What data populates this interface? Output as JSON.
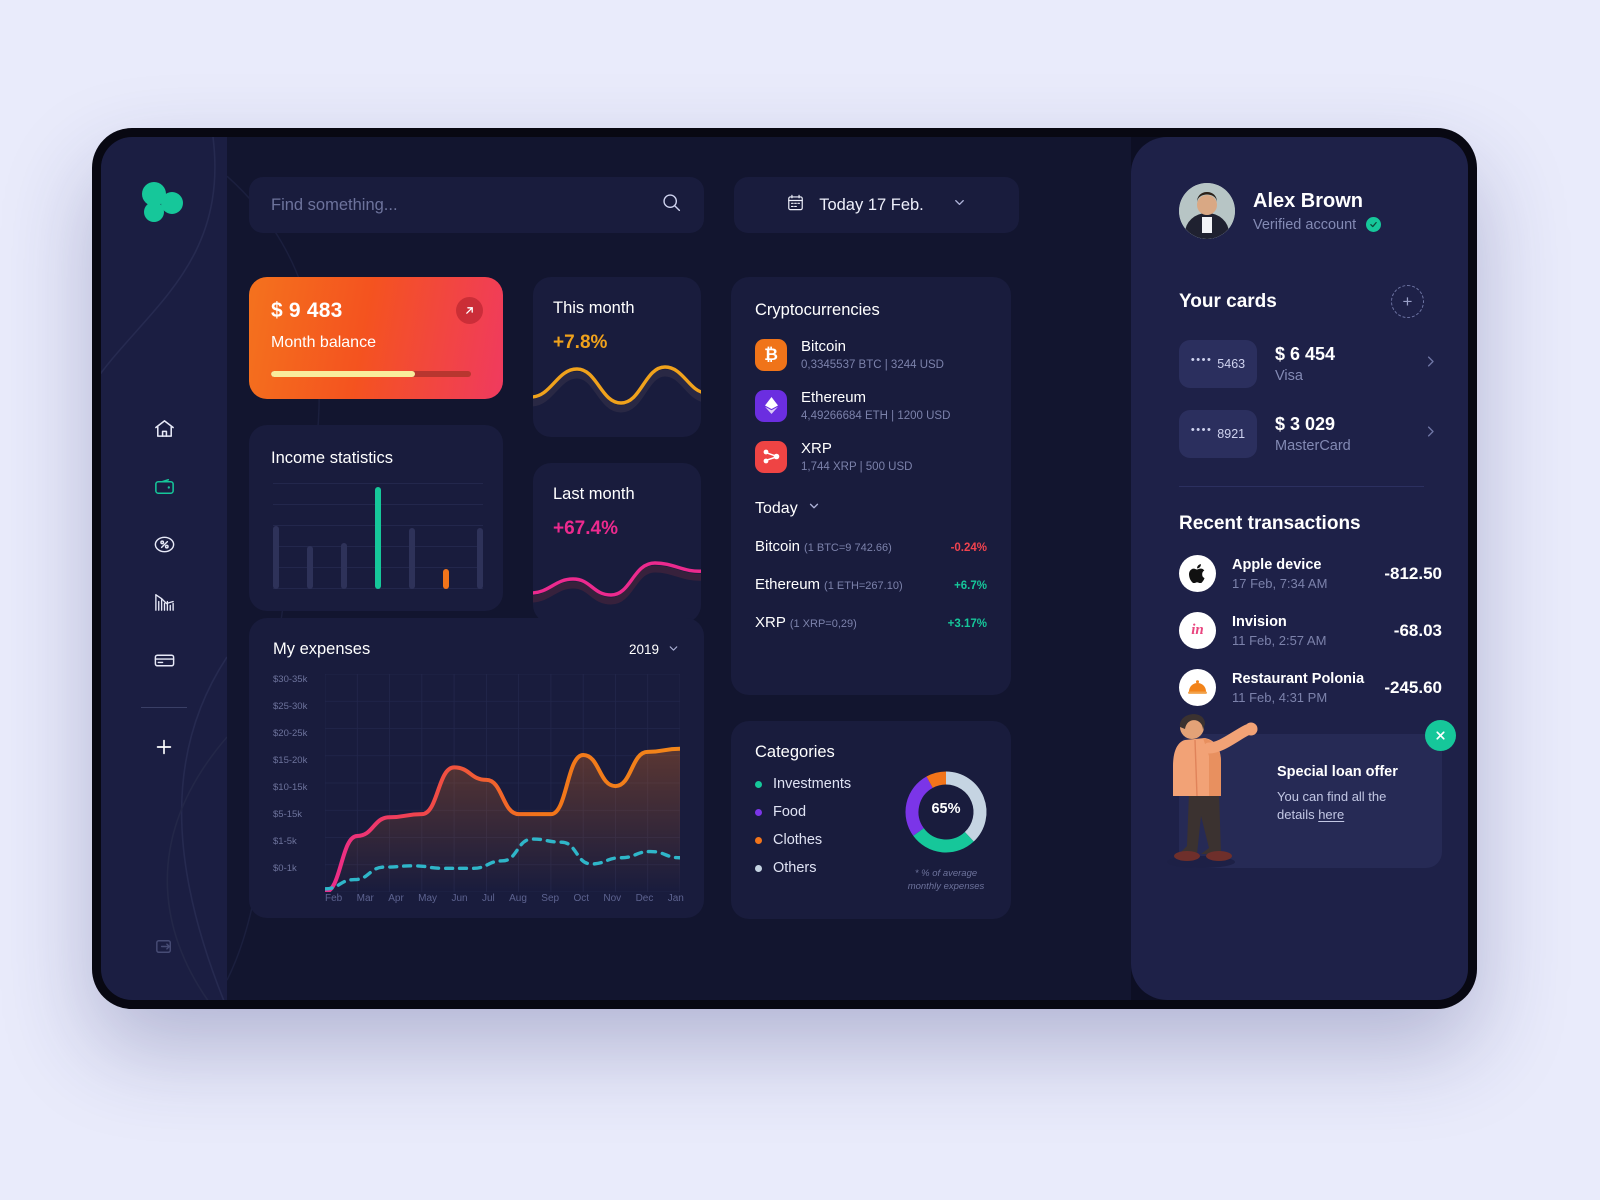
{
  "sidebar": {
    "logo_name": "three-circles-logo",
    "items": [
      {
        "name": "home",
        "icon": "home-icon",
        "active": false
      },
      {
        "name": "wallet",
        "icon": "wallet-icon",
        "active": true
      },
      {
        "name": "percent",
        "icon": "percent-icon",
        "active": false
      },
      {
        "name": "statistics",
        "icon": "bar-chart-icon",
        "active": false
      },
      {
        "name": "cards",
        "icon": "credit-card-icon",
        "active": false
      }
    ],
    "add_label": "+",
    "logout_icon": "logout-icon"
  },
  "topbar": {
    "search_placeholder": "Find something...",
    "search_value": "",
    "search_icon": "search-icon",
    "date_label": "Today 17 Feb.",
    "calendar_icon": "calendar-icon",
    "chevron_icon": "chevron-down-icon"
  },
  "balance": {
    "amount": "$ 9 483",
    "label": "Month balance",
    "progress_pct": 72,
    "arrow_icon": "arrow-up-right-icon"
  },
  "income": {
    "title": "Income statistics"
  },
  "this_month": {
    "title": "This month",
    "value": "+7.8%",
    "color": "#f0a21c"
  },
  "last_month": {
    "title": "Last month",
    "value": "+67.4%",
    "color": "#ec2a8e"
  },
  "crypto": {
    "title": "Cryptocurrencies",
    "holdings": [
      {
        "name": "Bitcoin",
        "detail": "0,3345537 BTC | 3244 USD",
        "icon": "bitcoin-icon",
        "color": "#f07419"
      },
      {
        "name": "Ethereum",
        "detail": "4,49266684 ETH | 1200 USD",
        "icon": "ethereum-icon",
        "color": "#6b2ee0"
      },
      {
        "name": "XRP",
        "detail": "1,744 XRP | 500 USD",
        "icon": "xrp-icon",
        "color": "#ef4444"
      }
    ],
    "today_label": "Today",
    "today_chevron": "chevron-down-icon",
    "rates": [
      {
        "name": "Bitcoin",
        "rate": "(1 BTC=9 742.66)",
        "change": "-0.24%",
        "color": "#f0434f"
      },
      {
        "name": "Ethereum",
        "rate": "(1 ETH=267.10)",
        "change": "+6.7%",
        "color": "#16c79a"
      },
      {
        "name": "XRP",
        "rate": "(1 XRP=0,29)",
        "change": "+3.17%",
        "color": "#16c79a"
      }
    ]
  },
  "categories": {
    "title": "Categories",
    "items": [
      {
        "label": "Investments",
        "color": "#16c79a"
      },
      {
        "label": "Food",
        "color": "#7b35e8"
      },
      {
        "label": "Clothes",
        "color": "#f2741a"
      },
      {
        "label": "Others",
        "color": "#c5d4e2"
      }
    ],
    "center_value": "65%",
    "footnote": "* % of average monthly expenses"
  },
  "expenses": {
    "title": "My expenses",
    "year": "2019",
    "chevron_icon": "chevron-down-icon"
  },
  "profile": {
    "name": "Alex Brown",
    "status": "Verified account",
    "verified_icon": "check-badge-icon",
    "avatar_name": "avatar"
  },
  "cards_section": {
    "title": "Your cards",
    "add_icon": "add-card-icon",
    "cards": [
      {
        "masked": "••••",
        "last4": "5463",
        "amount": "$ 6 454",
        "type": "Visa",
        "chevron": "chevron-right-icon"
      },
      {
        "masked": "••••",
        "last4": "8921",
        "amount": "$ 3 029",
        "type": "MasterCard",
        "chevron": "chevron-right-icon"
      }
    ]
  },
  "transactions": {
    "title": "Recent transactions",
    "items": [
      {
        "name": "Apple device",
        "date": "17 Feb, 7:34 AM",
        "amount": "-812.50",
        "icon": "apple-icon"
      },
      {
        "name": "Invision",
        "date": "11 Feb, 2:57 AM",
        "amount": "-68.03",
        "icon": "invision-icon"
      },
      {
        "name": "Restaurant Polonia",
        "date": "11 Feb, 4:31 PM",
        "amount": "-245.60",
        "icon": "food-dome-icon"
      }
    ]
  },
  "offer": {
    "title": "Special loan offer",
    "text_before": "You can find all the details ",
    "link": "here",
    "close_icon": "close-icon",
    "illustration": "person-with-cards-illustration"
  },
  "chart_data": [
    {
      "type": "bar",
      "title": "Income statistics",
      "categories": [
        "1",
        "2",
        "3",
        "4",
        "5",
        "6",
        "7"
      ],
      "values": [
        62,
        42,
        45,
        100,
        60,
        20,
        60
      ],
      "colors": [
        "#2e3259",
        "#2e3259",
        "#2e3259",
        "#16c79a",
        "#2e3259",
        "#f2741a",
        "#2e3259"
      ],
      "grid": true,
      "xlabel": "",
      "ylabel": "",
      "ylim": [
        0,
        100
      ]
    },
    {
      "type": "line",
      "title": "This month",
      "x": [
        0,
        1,
        2,
        3,
        4,
        5,
        6,
        7,
        8
      ],
      "series": [
        {
          "name": "This month",
          "values": [
            42,
            30,
            62,
            78,
            52,
            22,
            40,
            70,
            58
          ],
          "color": "#f0a21c"
        }
      ],
      "grid": false,
      "legend": "none"
    },
    {
      "type": "line",
      "title": "Last month",
      "x": [
        0,
        1,
        2,
        3,
        4,
        5,
        6,
        7,
        8
      ],
      "series": [
        {
          "name": "Last month",
          "values": [
            22,
            16,
            34,
            52,
            30,
            20,
            54,
            82,
            70
          ],
          "color": "#ec2a8e"
        }
      ],
      "grid": false,
      "legend": "none"
    },
    {
      "type": "area",
      "title": "My expenses",
      "xlabel": "",
      "ylabel": "",
      "categories": [
        "Feb",
        "Mar",
        "Apr",
        "May",
        "Jun",
        "Jul",
        "Aug",
        "Sep",
        "Oct",
        "Nov",
        "Dec",
        "Jan"
      ],
      "ytick_labels": [
        "$30-35k",
        "$25-30k",
        "$20-25k",
        "$15-20k",
        "$10-15k",
        "$5-15k",
        "$1-5k",
        "$0-1k"
      ],
      "ylim": [
        0,
        35
      ],
      "grid": true,
      "series": [
        {
          "name": "Expenses",
          "color": "#f2741a",
          "values": [
            0,
            9,
            12,
            12.5,
            20,
            18,
            12.5,
            12.5,
            22,
            17,
            22.5,
            23
          ]
        },
        {
          "name": "Savings",
          "color": "#2fb6c9",
          "values": [
            0.5,
            2,
            4,
            4.2,
            3.8,
            3.8,
            5,
            8.5,
            8,
            4.5,
            5.5,
            6.5,
            5.5
          ]
        }
      ]
    },
    {
      "type": "pie",
      "title": "Categories",
      "labels": [
        "Others",
        "Investments",
        "Food",
        "Clothes"
      ],
      "values": [
        38,
        27,
        27,
        8
      ],
      "colors": [
        "#c5d4e2",
        "#16c79a",
        "#7b35e8",
        "#f2741a"
      ],
      "center_label": "65%",
      "legend": "left"
    }
  ]
}
